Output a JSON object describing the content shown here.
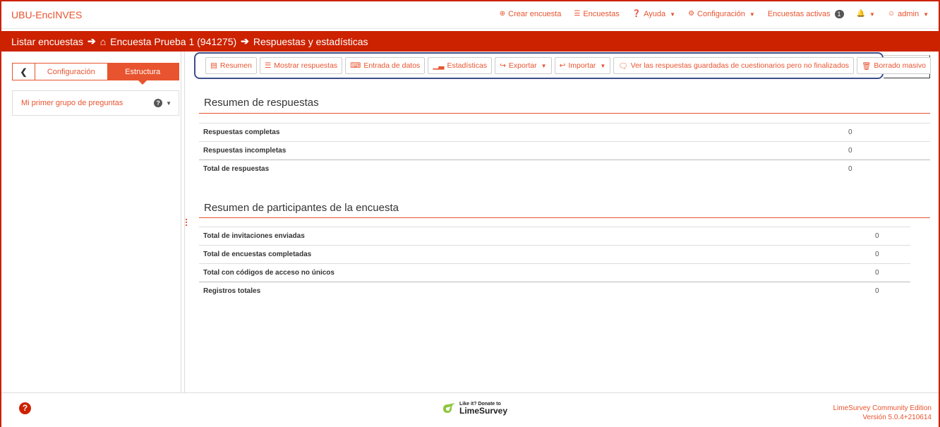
{
  "app": {
    "brand": "UBU-EncINVES"
  },
  "topnav": {
    "create_survey": "Crear encuesta",
    "surveys": "Encuestas",
    "help": "Ayuda",
    "configuration": "Configuración",
    "active_surveys": "Encuestas activas",
    "active_count": "1",
    "user": "admin"
  },
  "breadcrumb": {
    "list": "Listar encuestas",
    "survey": "Encuesta Prueba 1 (941275)",
    "current": "Respuestas y estadísticas"
  },
  "sidebar": {
    "tab_config": "Configuración",
    "tab_structure": "Estructura",
    "group_name": "Mi primer grupo de preguntas",
    "group_badge": "?"
  },
  "toolbar": {
    "summary": "Resumen",
    "show_responses": "Mostrar respuestas",
    "data_entry": "Entrada de datos",
    "statistics": "Estadísticas",
    "export": "Exportar",
    "import": "Importar",
    "saved_partial": "Ver las respuestas guardadas de cuestionarios pero no finalizados",
    "batch_delete": "Borrado masivo"
  },
  "response_summary": {
    "title": "Resumen de respuestas",
    "rows": [
      {
        "label": "Respuestas completas",
        "value": "0"
      },
      {
        "label": "Respuestas incompletas",
        "value": "0"
      },
      {
        "label": "Total de respuestas",
        "value": "0"
      }
    ]
  },
  "participant_summary": {
    "title": "Resumen de participantes de la encuesta",
    "rows": [
      {
        "label": "Total de invitaciones enviadas",
        "value": "0"
      },
      {
        "label": "Total de encuestas completadas",
        "value": "0"
      },
      {
        "label": "Total con códigos de acceso no únicos",
        "value": "0"
      },
      {
        "label": "Registros totales",
        "value": "0"
      }
    ]
  },
  "footer": {
    "donate_small": "Like it? Donate to",
    "donate_brand": "LimeSurvey",
    "edition": "LimeSurvey Community Edition",
    "version": "Versión 5.0.4+210614"
  },
  "colors": {
    "accent": "#e8542f",
    "brand_bar": "#cc2200",
    "toolbar_border": "#3d4f8a"
  }
}
